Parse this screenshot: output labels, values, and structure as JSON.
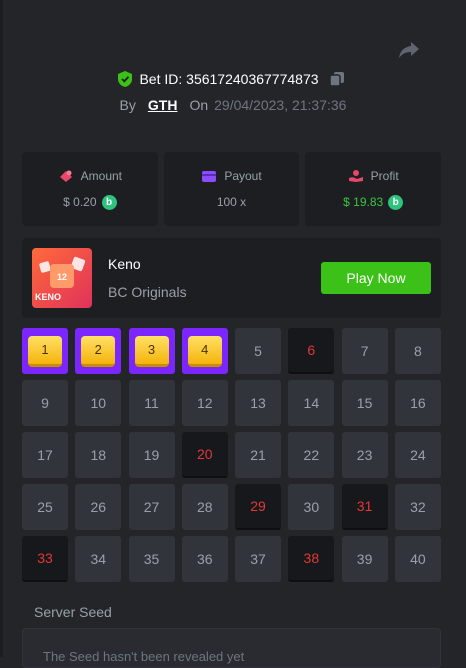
{
  "header": {
    "bet_id": "Bet ID: 35617240367774873",
    "by_label": "By",
    "user": "GTH",
    "on_label": "On",
    "date": "29/04/2023, 21:37:36"
  },
  "stats": {
    "amount_label": "Amount",
    "amount_value": "$ 0.20",
    "payout_label": "Payout",
    "payout_value": "100 x",
    "profit_label": "Profit",
    "profit_value": "$ 19.83",
    "coin_glyph": "b"
  },
  "game": {
    "name": "Keno",
    "provider": "BC Originals",
    "thumb_label": "KENO",
    "thumb_number": "12",
    "play_label": "Play Now"
  },
  "board": {
    "numbers": [
      "1",
      "2",
      "3",
      "4",
      "5",
      "6",
      "7",
      "8",
      "9",
      "10",
      "11",
      "12",
      "13",
      "14",
      "15",
      "16",
      "17",
      "18",
      "19",
      "20",
      "21",
      "22",
      "23",
      "24",
      "25",
      "26",
      "27",
      "28",
      "29",
      "30",
      "31",
      "32",
      "33",
      "34",
      "35",
      "36",
      "37",
      "38",
      "39",
      "40"
    ],
    "picked": [
      1,
      2,
      3,
      4
    ],
    "drawn": [
      6,
      20,
      29,
      31,
      33,
      38
    ]
  },
  "seed": {
    "label": "Server Seed",
    "text": "The Seed hasn't been revealed yet"
  },
  "colors": {
    "picked": "#7b25ff",
    "hit": "#e23838",
    "accent_green": "#3bc117"
  }
}
